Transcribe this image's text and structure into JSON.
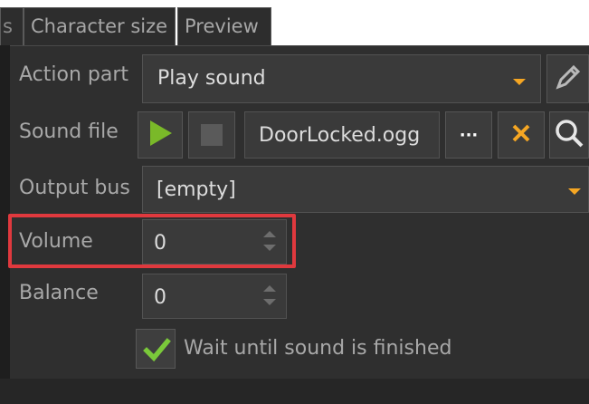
{
  "tabs": [
    {
      "label": "s"
    },
    {
      "label": "Character size"
    },
    {
      "label": "Preview"
    }
  ],
  "form": {
    "action_part": {
      "label": "Action part",
      "value": "Play sound"
    },
    "sound_file": {
      "label": "Sound file",
      "value": "DoorLocked.ogg",
      "browse_label": "···"
    },
    "output_bus": {
      "label": "Output bus",
      "value": "[empty]"
    },
    "volume": {
      "label": "Volume",
      "value": "0"
    },
    "balance": {
      "label": "Balance",
      "value": "0"
    },
    "wait_checkbox": {
      "label": "Wait until sound is finished",
      "checked": true
    }
  },
  "colors": {
    "accent": "#f5a623",
    "play_green": "#7ab929",
    "check_green": "#7ac93a",
    "highlight_red": "#e0393e",
    "panel_bg": "#2f2f2f"
  },
  "icons": {
    "edit": "pencil-icon",
    "play": "play-icon",
    "stop": "stop-icon",
    "clear": "close-icon",
    "search": "search-icon",
    "dropdown": "chevron-down-icon",
    "spinner": "spinner-arrows-icon",
    "check": "check-icon"
  }
}
